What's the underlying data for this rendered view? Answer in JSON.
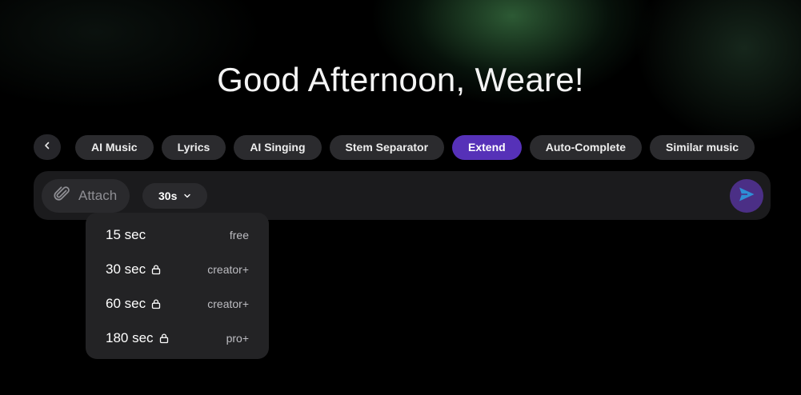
{
  "greeting": "Good Afternoon, Weare!",
  "tabs": {
    "back_icon": "chevron-left-icon",
    "items": [
      {
        "label": "AI Music"
      },
      {
        "label": "Lyrics"
      },
      {
        "label": "AI Singing"
      },
      {
        "label": "Stem Separator"
      },
      {
        "label": "Extend",
        "active": true
      },
      {
        "label": "Auto-Complete"
      },
      {
        "label": "Similar music"
      }
    ]
  },
  "composer": {
    "attach_label": "Attach",
    "attach_icon": "paperclip-icon",
    "duration_value": "30s",
    "duration_icon": "chevron-down-icon",
    "send_icon": "send-icon"
  },
  "duration_menu": {
    "options": [
      {
        "label": "15 sec",
        "tier": "free",
        "locked": false
      },
      {
        "label": "30 sec",
        "tier": "creator+",
        "locked": true
      },
      {
        "label": "60 sec",
        "tier": "creator+",
        "locked": true
      },
      {
        "label": "180 sec",
        "tier": "pro+",
        "locked": true
      }
    ]
  },
  "colors": {
    "active_tab": "#5631b8",
    "send_button": "#4b2f86",
    "send_arrow": "#2e8fd6"
  }
}
